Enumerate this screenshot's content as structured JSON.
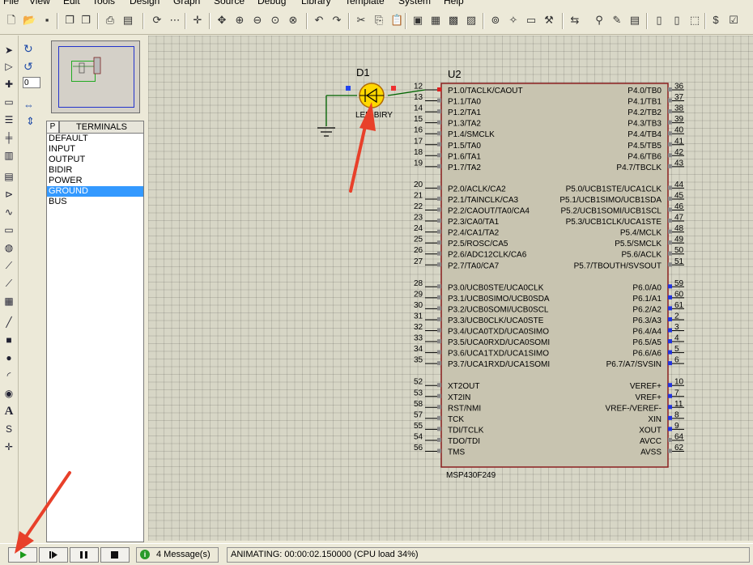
{
  "menu": [
    "File",
    "View",
    "Edit",
    "Tools",
    "Design",
    "Graph",
    "Source",
    "Debug",
    "Library",
    "Template",
    "System",
    "Help"
  ],
  "left_tools": {
    "rotate_value": "0"
  },
  "side_panel": {
    "p_button": "P",
    "header": "TERMINALS",
    "items": [
      "DEFAULT",
      "INPUT",
      "OUTPUT",
      "BIDIR",
      "POWER",
      "GROUND",
      "BUS"
    ],
    "selected": "GROUND"
  },
  "schematic": {
    "led": {
      "ref": "D1",
      "value": "LED-BIRY"
    },
    "chip": {
      "ref": "U2",
      "part": "MSP430F249",
      "left_pins": [
        {
          "num": "12",
          "label": "P1.0/TACLK/CAOUT"
        },
        {
          "num": "13",
          "label": "P1.1/TA0"
        },
        {
          "num": "14",
          "label": "P1.2/TA1"
        },
        {
          "num": "15",
          "label": "P1.3/TA2"
        },
        {
          "num": "16",
          "label": "P1.4/SMCLK"
        },
        {
          "num": "17",
          "label": "P1.5/TA0"
        },
        {
          "num": "18",
          "label": "P1.6/TA1"
        },
        {
          "num": "19",
          "label": "P1.7/TA2"
        },
        {
          "num": "20",
          "label": "P2.0/ACLK/CA2"
        },
        {
          "num": "21",
          "label": "P2.1/TAINCLK/CA3"
        },
        {
          "num": "22",
          "label": "P2.2/CAOUT/TA0/CA4"
        },
        {
          "num": "23",
          "label": "P2.3/CA0/TA1"
        },
        {
          "num": "24",
          "label": "P2.4/CA1/TA2"
        },
        {
          "num": "25",
          "label": "P2.5/ROSC/CA5"
        },
        {
          "num": "26",
          "label": "P2.6/ADC12CLK/CA6"
        },
        {
          "num": "27",
          "label": "P2.7/TA0/CA7"
        },
        {
          "num": "28",
          "label": "P3.0/UCB0STE/UCA0CLK"
        },
        {
          "num": "29",
          "label": "P3.1/UCB0SIMO/UCB0SDA"
        },
        {
          "num": "30",
          "label": "P3.2/UCB0SOMI/UCB0SCL"
        },
        {
          "num": "31",
          "label": "P3.3/UCB0CLK/UCA0STE"
        },
        {
          "num": "32",
          "label": "P3.4/UCA0TXD/UCA0SIMO"
        },
        {
          "num": "33",
          "label": "P3.5/UCA0RXD/UCA0SOMI"
        },
        {
          "num": "34",
          "label": "P3.6/UCA1TXD/UCA1SIMO"
        },
        {
          "num": "35",
          "label": "P3.7/UCA1RXD/UCA1SOMI"
        },
        {
          "num": "52",
          "label": "XT2OUT"
        },
        {
          "num": "53",
          "label": "XT2IN"
        },
        {
          "num": "58",
          "label": "RST/NMI"
        },
        {
          "num": "57",
          "label": "TCK"
        },
        {
          "num": "55",
          "label": "TDI/TCLK"
        },
        {
          "num": "54",
          "label": "TDO/TDI"
        },
        {
          "num": "56",
          "label": "TMS"
        }
      ],
      "right_pins": [
        {
          "num": "36",
          "label": "P4.0/TB0"
        },
        {
          "num": "37",
          "label": "P4.1/TB1"
        },
        {
          "num": "38",
          "label": "P4.2/TB2"
        },
        {
          "num": "39",
          "label": "P4.3/TB3"
        },
        {
          "num": "40",
          "label": "P4.4/TB4"
        },
        {
          "num": "41",
          "label": "P4.5/TB5"
        },
        {
          "num": "42",
          "label": "P4.6/TB6"
        },
        {
          "num": "43",
          "label": "P4.7/TBCLK"
        },
        {
          "num": "44",
          "label": "P5.0/UCB1STE/UCA1CLK"
        },
        {
          "num": "45",
          "label": "P5.1/UCB1SIMO/UCB1SDA"
        },
        {
          "num": "46",
          "label": "P5.2/UCB1SOMI/UCB1SCL"
        },
        {
          "num": "47",
          "label": "P5.3/UCB1CLK/UCA1STE"
        },
        {
          "num": "48",
          "label": "P5.4/MCLK"
        },
        {
          "num": "49",
          "label": "P5.5/SMCLK"
        },
        {
          "num": "50",
          "label": "P5.6/ACLK"
        },
        {
          "num": "51",
          "label": "P5.7/TBOUTH/SVSOUT"
        },
        {
          "num": "59",
          "label": "P6.0/A0"
        },
        {
          "num": "60",
          "label": "P6.1/A1"
        },
        {
          "num": "61",
          "label": "P6.2/A2"
        },
        {
          "num": "2",
          "label": "P6.3/A3"
        },
        {
          "num": "3",
          "label": "P6.4/A4"
        },
        {
          "num": "4",
          "label": "P6.5/A5"
        },
        {
          "num": "5",
          "label": "P6.6/A6"
        },
        {
          "num": "6",
          "label": "P6.7/A7/SVSIN"
        },
        {
          "num": "10",
          "label": "VEREF+"
        },
        {
          "num": "7",
          "label": "VREF+"
        },
        {
          "num": "11",
          "label": "VREF-/VEREF-"
        },
        {
          "num": "8",
          "label": "XIN"
        },
        {
          "num": "9",
          "label": "XOUT"
        },
        {
          "num": "64",
          "label": "AVCC"
        },
        {
          "num": "62",
          "label": "AVSS"
        }
      ]
    }
  },
  "status": {
    "messages": "4 Message(s)",
    "animating": "ANIMATING: 00:00:02.150000 (CPU load 34%)"
  },
  "colors": {
    "chip_fill": "#c8c4b0",
    "chip_border": "#8a1f1f",
    "wire": "#006400",
    "led_fill": "#ffd800",
    "annotation_arrow": "#e8402a",
    "selection": "#3399ff",
    "play_green": "#1a9a1a"
  }
}
